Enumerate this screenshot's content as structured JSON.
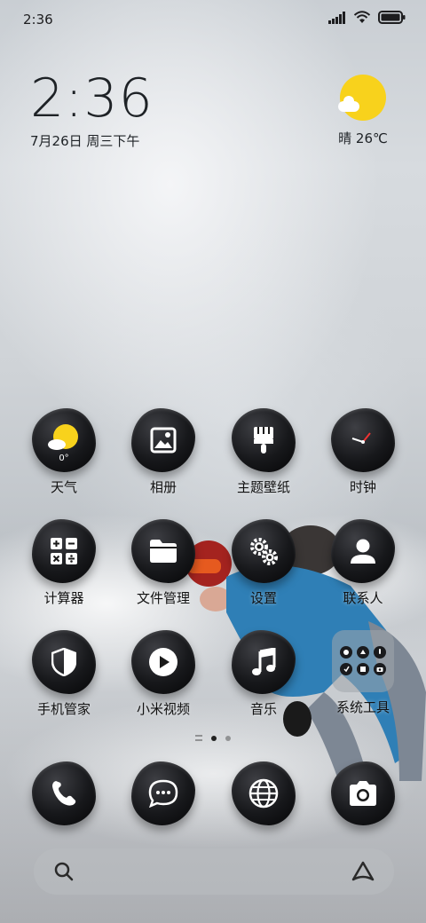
{
  "status_bar": {
    "time": "2:36",
    "icons": [
      "signal-icon",
      "wifi-icon",
      "battery-icon"
    ]
  },
  "clock_widget": {
    "time": "2:36",
    "date": "7月26日 周三下午"
  },
  "weather_widget": {
    "text": "晴 26℃",
    "icon": "sunny-cloud-icon"
  },
  "apps": [
    {
      "label": "天气",
      "icon": "weather-icon",
      "temp": "0°"
    },
    {
      "label": "相册",
      "icon": "gallery-icon"
    },
    {
      "label": "主题壁纸",
      "icon": "paintbrush-icon"
    },
    {
      "label": "时钟",
      "icon": "clock-icon"
    },
    {
      "label": "计算器",
      "icon": "calculator-icon"
    },
    {
      "label": "文件管理",
      "icon": "folder-icon"
    },
    {
      "label": "设置",
      "icon": "gear-icon"
    },
    {
      "label": "联系人",
      "icon": "person-icon"
    },
    {
      "label": "手机管家",
      "icon": "shield-icon"
    },
    {
      "label": "小米视频",
      "icon": "play-icon"
    },
    {
      "label": "音乐",
      "icon": "music-note-icon"
    },
    {
      "label": "系统工具",
      "icon": "folder-grid-icon"
    }
  ],
  "dock": [
    {
      "name": "phone",
      "icon": "phone-icon"
    },
    {
      "name": "messages",
      "icon": "chat-bubble-icon"
    },
    {
      "name": "browser",
      "icon": "globe-icon"
    },
    {
      "name": "camera",
      "icon": "camera-icon"
    }
  ],
  "page_indicator": {
    "pages": 2,
    "active": 1
  },
  "search_bar": {
    "left_icon": "search-icon",
    "right_icon": "assistant-icon"
  },
  "colors": {
    "sun": "#f8d21c",
    "icon_blob": "#17181b"
  }
}
